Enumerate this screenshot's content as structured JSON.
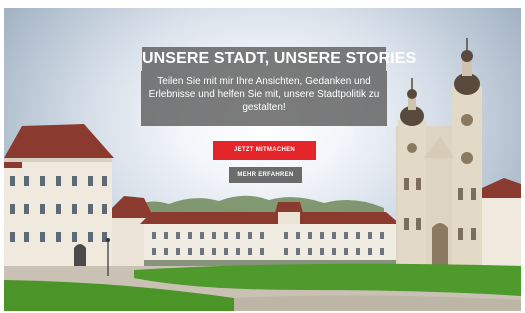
{
  "hero": {
    "headline": "UNSERE STADT, UNSERE STORIES",
    "subtext": "Teilen Sie mit mir Ihre Ansichten, Gedanken und Erlebnisse und helfen Sie mit, unsere Stadtpolitik zu gestalten!",
    "primary_button": "JETZT MITMACHEN",
    "secondary_button": "MEHR ERFAHREN"
  },
  "colors": {
    "primary_button": "#e4262a",
    "secondary_button": "#6b6b6b",
    "text_panel": "#5e5e5e",
    "lawn": "#4f9a2c",
    "sky": "#d5dee8"
  },
  "background_image": {
    "subject": "photograph of an abbey courtyard with a baroque twin-tower cathedral, historic buildings and a green lawn"
  }
}
